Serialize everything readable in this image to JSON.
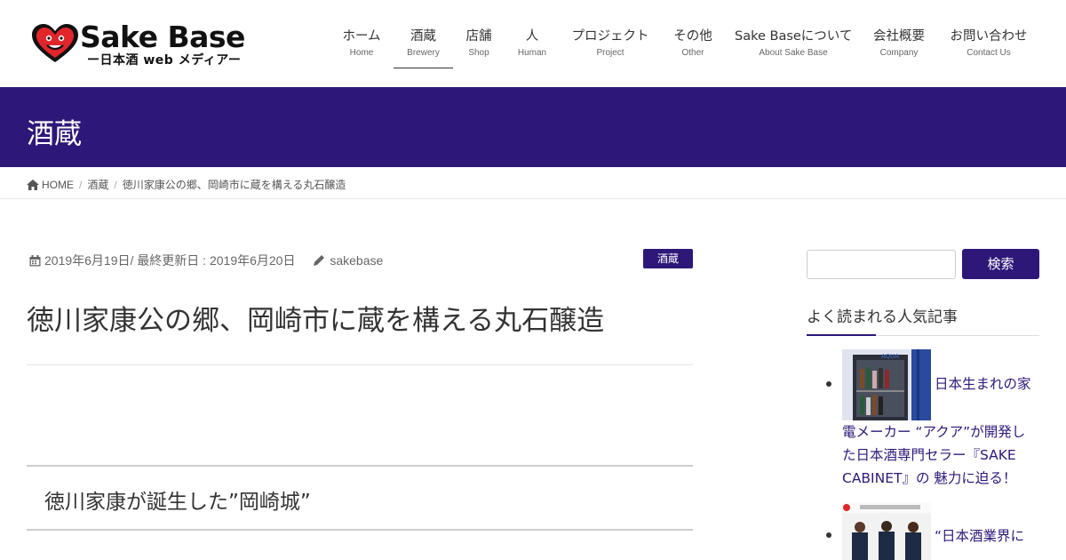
{
  "logo": {
    "title": "Sake Base",
    "subtitle": "ー日本酒 web メディアー"
  },
  "nav": [
    {
      "label": "ホーム",
      "sub": "Home"
    },
    {
      "label": "酒蔵",
      "sub": "Brewery",
      "active": true
    },
    {
      "label": "店舗",
      "sub": "Shop"
    },
    {
      "label": "人",
      "sub": "Human"
    },
    {
      "label": "プロジェクト",
      "sub": "Project"
    },
    {
      "label": "その他",
      "sub": "Other"
    },
    {
      "label": "Sake Baseについて",
      "sub": "About Sake Base"
    },
    {
      "label": "会社概要",
      "sub": "Company"
    },
    {
      "label": "お問い合わせ",
      "sub": "Contact Us"
    }
  ],
  "page_title": "酒蔵",
  "breadcrumb": {
    "home": "HOME",
    "category": "酒蔵",
    "current": "徳川家康公の郷、岡崎市に蔵を構える丸石醸造"
  },
  "article": {
    "date": "2019年6月19日",
    "updated": " / 最終更新日 : 2019年6月20日",
    "author": "sakebase",
    "category": "酒蔵",
    "title": "徳川家康公の郷、岡崎市に蔵を構える丸石醸造",
    "heading": "徳川家康が誕生した”岡崎城”"
  },
  "sidebar": {
    "search_button": "検索",
    "widget_title": "よく読まれる人気記事",
    "posts": [
      {
        "title_line1": "日本生まれの家",
        "title_rest": "電メーカー “アクア”が開発した日本酒専門セラー『SAKE CABINET』の 魅力に迫る！"
      },
      {
        "title_line1": "“日本酒業界に",
        "title_rest": ""
      }
    ]
  },
  "colors": {
    "brand": "#2d1879",
    "text": "#333333"
  }
}
